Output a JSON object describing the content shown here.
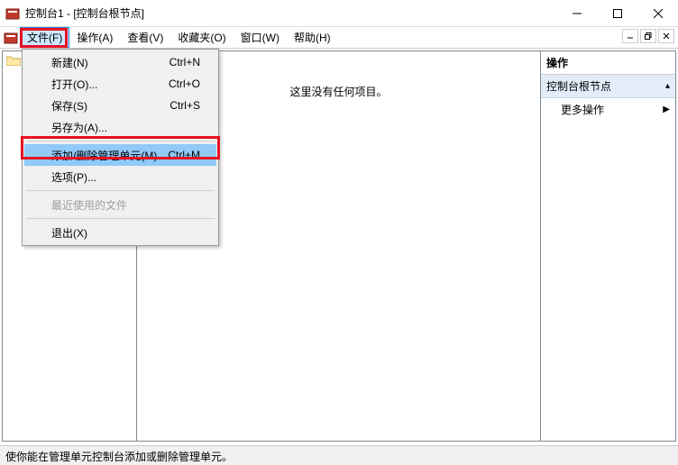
{
  "window": {
    "title": "控制台1 - [控制台根节点]"
  },
  "menubar": {
    "items": [
      "文件(F)",
      "操作(A)",
      "查看(V)",
      "收藏夹(O)",
      "窗口(W)",
      "帮助(H)"
    ]
  },
  "dropdown": {
    "new": {
      "label": "新建(N)",
      "shortcut": "Ctrl+N"
    },
    "open": {
      "label": "打开(O)...",
      "shortcut": "Ctrl+O"
    },
    "save": {
      "label": "保存(S)",
      "shortcut": "Ctrl+S"
    },
    "saveas": {
      "label": "另存为(A)..."
    },
    "addremove": {
      "label": "添加/删除管理单元(M)...",
      "shortcut": "Ctrl+M"
    },
    "options": {
      "label": "选项(P)..."
    },
    "recent": {
      "label": "最近使用的文件"
    },
    "exit": {
      "label": "退出(X)"
    }
  },
  "center": {
    "empty": "这里没有任何项目。"
  },
  "actions": {
    "title": "操作",
    "rootnode": "控制台根节点",
    "more": "更多操作"
  },
  "status": {
    "text": "使你能在管理单元控制台添加或删除管理单元。"
  }
}
